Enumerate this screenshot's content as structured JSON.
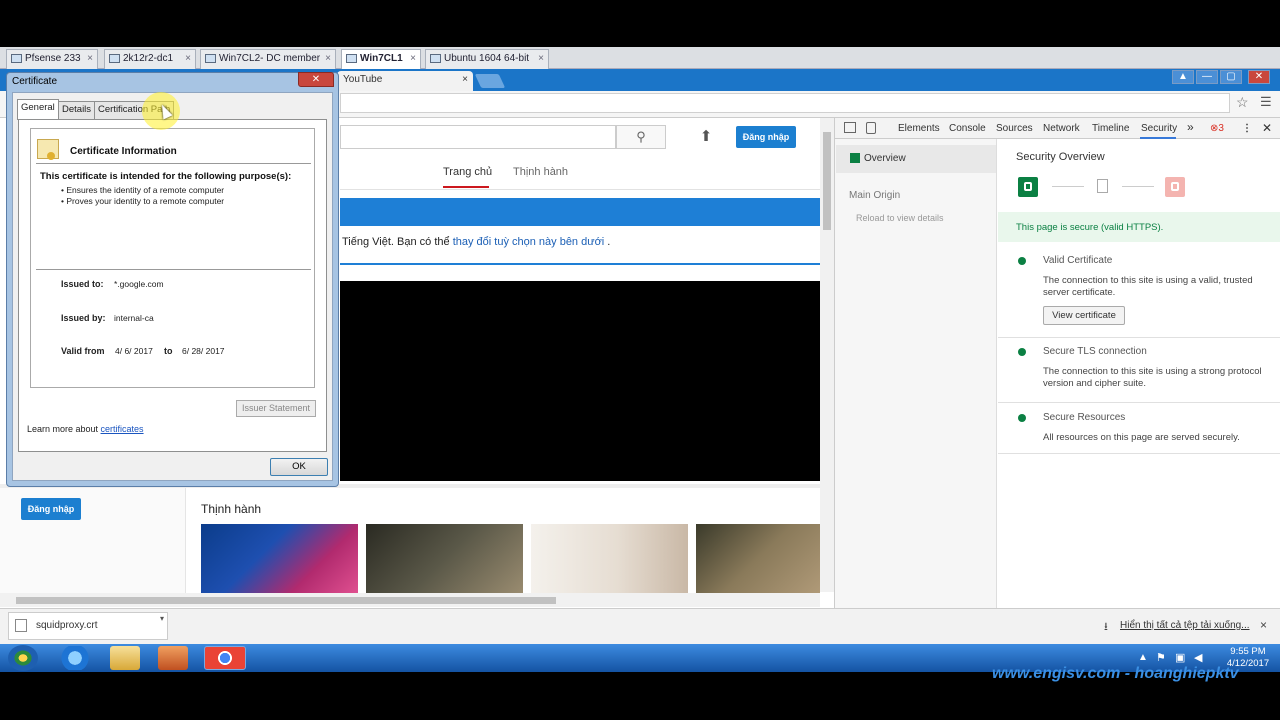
{
  "vm_tabs": [
    {
      "label": "Pfsense 233",
      "close": "×"
    },
    {
      "label": "2k12r2-dc1",
      "close": "×"
    },
    {
      "label": "Win7CL2- DC member",
      "close": "×"
    },
    {
      "label": "Win7CL1",
      "close": "×"
    },
    {
      "label": "Ubuntu 1604 64-bit",
      "close": "×"
    }
  ],
  "browser": {
    "tab_title": "YouTube",
    "tab_close": "×",
    "window_buttons": [
      "▲",
      "—",
      "▢",
      "✕"
    ]
  },
  "youtube": {
    "sign_in_label": "Đăng nhập",
    "nav": [
      "Trang chủ",
      "Thịnh hành"
    ],
    "lang_notice_prefix": "Tiếng Việt. Bạn có thể ",
    "lang_notice_link": "thay đổi tuỳ chọn này bên dưới",
    "lang_notice_suffix": " .",
    "trending_title": "Thịnh hành"
  },
  "devtools": {
    "tabs": [
      "Elements",
      "Console",
      "Sources",
      "Network",
      "Timeline",
      "Security"
    ],
    "more": "»",
    "error_count": "3",
    "active_tab": "Security",
    "left": {
      "overview": "Overview",
      "main_origin": "Main Origin",
      "reload_hint": "Reload to view details"
    },
    "security": {
      "title": "Security Overview",
      "banner": "This page is secure (valid HTTPS).",
      "items": [
        {
          "title": "Valid Certificate",
          "desc": "The connection to this site is using a valid, trusted server certificate."
        },
        {
          "title": "Secure TLS connection",
          "desc": "The connection to this site is using a strong protocol version and cipher suite."
        },
        {
          "title": "Secure Resources",
          "desc": "All resources on this page are served securely."
        }
      ],
      "view_cert_label": "View certificate",
      "colors": {
        "secure": "#0b8043",
        "insecure": "#f4b4b0"
      }
    }
  },
  "certificate": {
    "window_title": "Certificate",
    "close": "✕",
    "tabs": [
      "General",
      "Details",
      "Certification Path"
    ],
    "info_title": "Certificate Information",
    "purpose_heading": "This certificate is intended for the following purpose(s):",
    "purposes": [
      "• Ensures the identity of a remote computer",
      "• Proves your identity to a remote computer"
    ],
    "issued_to_label": "Issued to:",
    "issued_to": "*.google.com",
    "issued_by_label": "Issued by:",
    "issued_by": "internal-ca",
    "valid_from_label": "Valid from",
    "valid_from": "4/ 6/ 2017",
    "to_label": "to",
    "valid_to": "6/ 28/ 2017",
    "issuer_statement": "Issuer Statement",
    "learn_more_prefix": "Learn more about ",
    "learn_more_link": "certificates",
    "ok": "OK"
  },
  "downloads": {
    "file": "squidproxy.crt",
    "show_all": "Hiển thị tất cả tệp tải xuống...",
    "close": "×"
  },
  "taskbar": {
    "time": "9:55 PM",
    "date": "4/12/2017"
  },
  "watermark": "www.engisv.com - hoanghiepktv"
}
